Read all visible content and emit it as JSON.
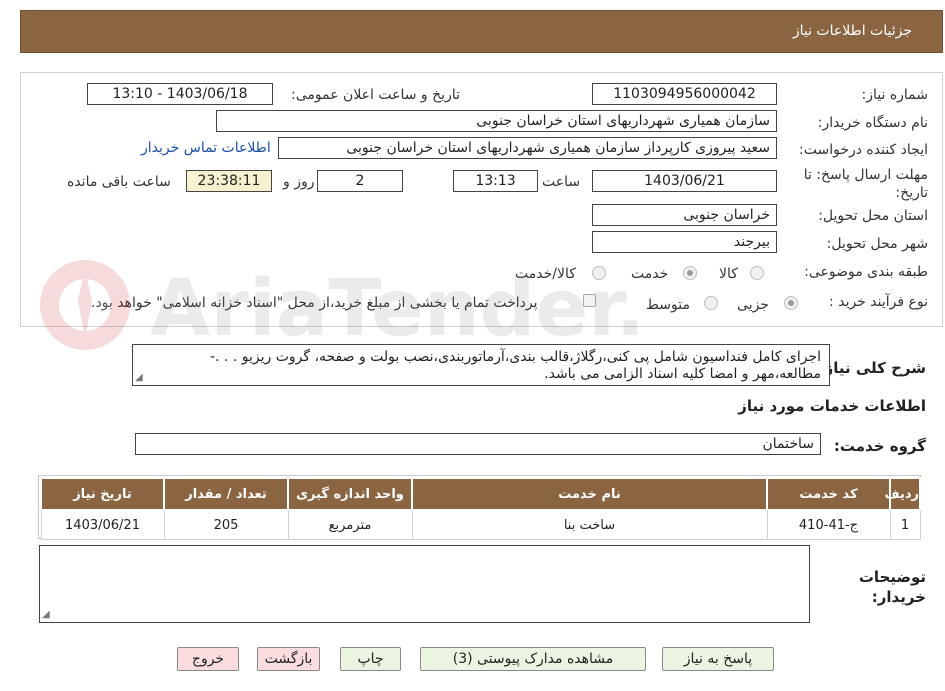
{
  "header": {
    "title": "جزئیات اطلاعات نیاز"
  },
  "form": {
    "need_number": {
      "label": "شماره نیاز:",
      "value": "1103094956000042"
    },
    "announce_datetime": {
      "label": "تاریخ و ساعت اعلان عمومی:",
      "value": "1403/06/18 - 13:10"
    },
    "buyer_org": {
      "label": "نام دستگاه خریدار:",
      "value": "سازمان همیاری شهرداریهای استان خراسان جنوبی"
    },
    "requester": {
      "label": "ایجاد کننده درخواست:",
      "value": "سعید پیروزی کارپرداز سازمان همیاری شهرداریهای استان خراسان جنوبی"
    },
    "buyer_contact_link": "اطلاعات تماس خریدار",
    "deadline": {
      "label": "مهلت ارسال پاسخ: تا تاریخ:",
      "date": "1403/06/21",
      "time_label": "ساعت",
      "time": "13:13",
      "days": "2",
      "days_label": "روز و",
      "remaining": "23:38:11",
      "remaining_label": "ساعت باقی مانده"
    },
    "delivery_province": {
      "label": "استان محل تحویل:",
      "value": "خراسان جنوبی"
    },
    "delivery_city": {
      "label": "شهر محل تحویل:",
      "value": "بیرجند"
    },
    "category": {
      "label": "طبقه بندی موضوعی:",
      "options": [
        "کالا",
        "خدمت",
        "کالا/خدمت"
      ],
      "selected": "خدمت"
    },
    "purchase_process": {
      "label": "نوع فرآیند خرید :",
      "options": [
        "جزیی",
        "متوسط"
      ],
      "selected": "جزیی",
      "note": "پرداخت تمام یا بخشی از مبلغ خرید،از محل \"اسناد خزانه اسلامی\" خواهد بود."
    }
  },
  "description": {
    "label": "شرح کلی نیاز:",
    "text": "اجرای کامل فنداسیون شامل پی کنی،رگلاژ،قالب بندی،آرماتوربندی،نصب بولت و صفحه، گروت ریزیو . . .- مطالعه،مهر و امضا کلیه اسناد الزامی می باشد."
  },
  "services": {
    "section_title": "اطلاعات خدمات مورد نیاز",
    "group_label": "گروه خدمت:",
    "group_value": "ساختمان",
    "columns": [
      "ردیف",
      "کد خدمت",
      "نام خدمت",
      "واحد اندازه گیری",
      "تعداد / مقدار",
      "تاریخ نیاز"
    ],
    "rows": [
      {
        "row": "1",
        "code": "ج-41-410",
        "name": "ساخت بنا",
        "unit": "مترمربع",
        "qty": "205",
        "date": "1403/06/21"
      }
    ]
  },
  "buyer_notes": {
    "label": "توضیحات خریدار:",
    "value": ""
  },
  "buttons": {
    "reply": "پاسخ به نیاز",
    "attachments": "مشاهده مدارک پیوستی (3)",
    "print": "چاپ",
    "back": "بازگشت",
    "exit": "خروج"
  },
  "watermark": {
    "text": "AriaTender.neT"
  },
  "colors": {
    "header_bg": "#8b6542",
    "link": "#1a4fa8",
    "remaining_bg": "#f6f1cf",
    "button_green": "#ecf5e1",
    "button_red": "#fbdde0"
  }
}
